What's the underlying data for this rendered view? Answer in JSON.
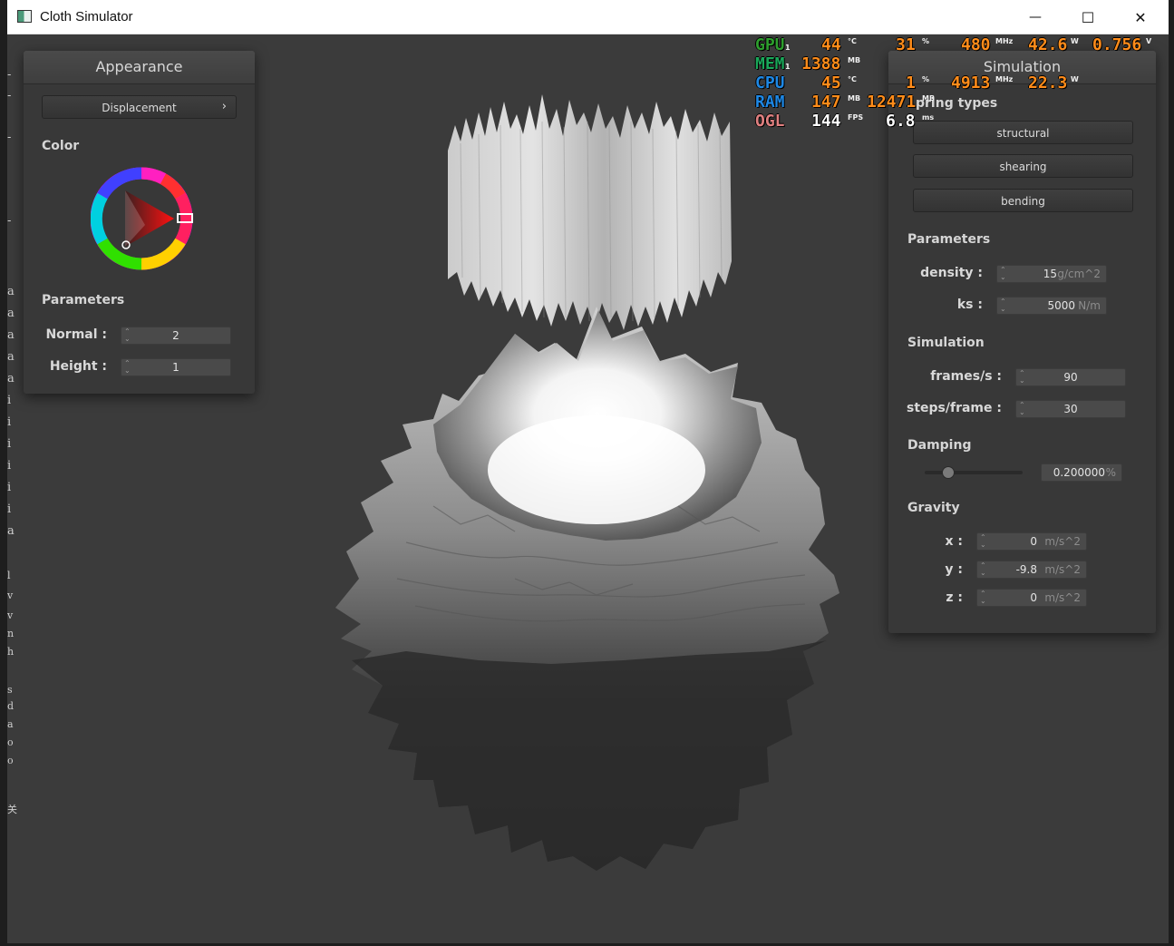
{
  "window": {
    "title": "Cloth Simulator",
    "minimize": "—",
    "maximize": "☐",
    "close": "✕"
  },
  "appearance": {
    "header": "Appearance",
    "mode_button": "Displacement",
    "mode_chevron": "›",
    "color_label": "Color",
    "parameters_label": "Parameters",
    "normal_label": "Normal :",
    "normal_value": "2",
    "height_label": "Height :",
    "height_value": "1"
  },
  "simulation": {
    "header": "Simulation",
    "spring_types_label": "pring types",
    "buttons": [
      "structural",
      "shearing",
      "bending"
    ],
    "parameters_label": "Parameters",
    "density_label": "density :",
    "density_value": "15",
    "density_unit": "g/cm^2",
    "ks_label": "ks :",
    "ks_value": "5000",
    "ks_unit": "N/m",
    "simulation_label": "Simulation",
    "fps_label": "frames/s :",
    "fps_value": "90",
    "steps_label": "steps/frame :",
    "steps_value": "30",
    "damping_label": "Damping",
    "damping_value": "0.200000",
    "damping_unit": "%",
    "damping_fraction": 0.2,
    "gravity_label": "Gravity",
    "gx_label": "x :",
    "gx_value": "0",
    "gx_unit": "m/s^2",
    "gy_label": "y :",
    "gy_value": "-9.8",
    "gy_unit": "m/s^2",
    "gz_label": "z :",
    "gz_value": "0",
    "gz_unit": "m/s^2"
  },
  "osd": {
    "gpu": {
      "label": "GPU",
      "sub": "1",
      "temp": "44",
      "temp_unit": "°C",
      "load": "31",
      "load_unit": "%",
      "clock": "480",
      "clock_unit": "MHz",
      "power": "42.6",
      "power_unit": "W",
      "volt": "0.756",
      "volt_unit": "V"
    },
    "mem": {
      "label": "MEM",
      "sub": "1",
      "used": "1388",
      "used_unit": "MB"
    },
    "cpu": {
      "label": "CPU",
      "temp": "45",
      "temp_unit": "°C",
      "load": "1",
      "load_unit": "%",
      "clock": "4913",
      "clock_unit": "MHz",
      "power": "22.3",
      "power_unit": "W"
    },
    "ram": {
      "label": "RAM",
      "used": "147",
      "used_unit": "MB",
      "total": "12471",
      "total_unit": "MB"
    },
    "ogl": {
      "label": "OGL",
      "fps": "144",
      "fps_unit": "FPS",
      "frametime": "6.8",
      "frametime_unit": "ms"
    },
    "colors": {
      "gpu": "#2e9e2e",
      "mem": "#1aa85a",
      "cpu": "#1e88e5",
      "ram": "#1e88e5",
      "ogl": "#e08080",
      "value": "#ff8c1a",
      "white": "#ffffff"
    }
  },
  "background_text": [
    "-",
    "-",
    "-",
    "-",
    "a",
    "a",
    "a",
    "a",
    "a",
    "i",
    "i",
    "i",
    "i",
    "i",
    "i",
    "a",
    "l",
    "v",
    "v",
    "n",
    "h",
    "s",
    "d",
    "a",
    "o",
    "o",
    "关"
  ]
}
